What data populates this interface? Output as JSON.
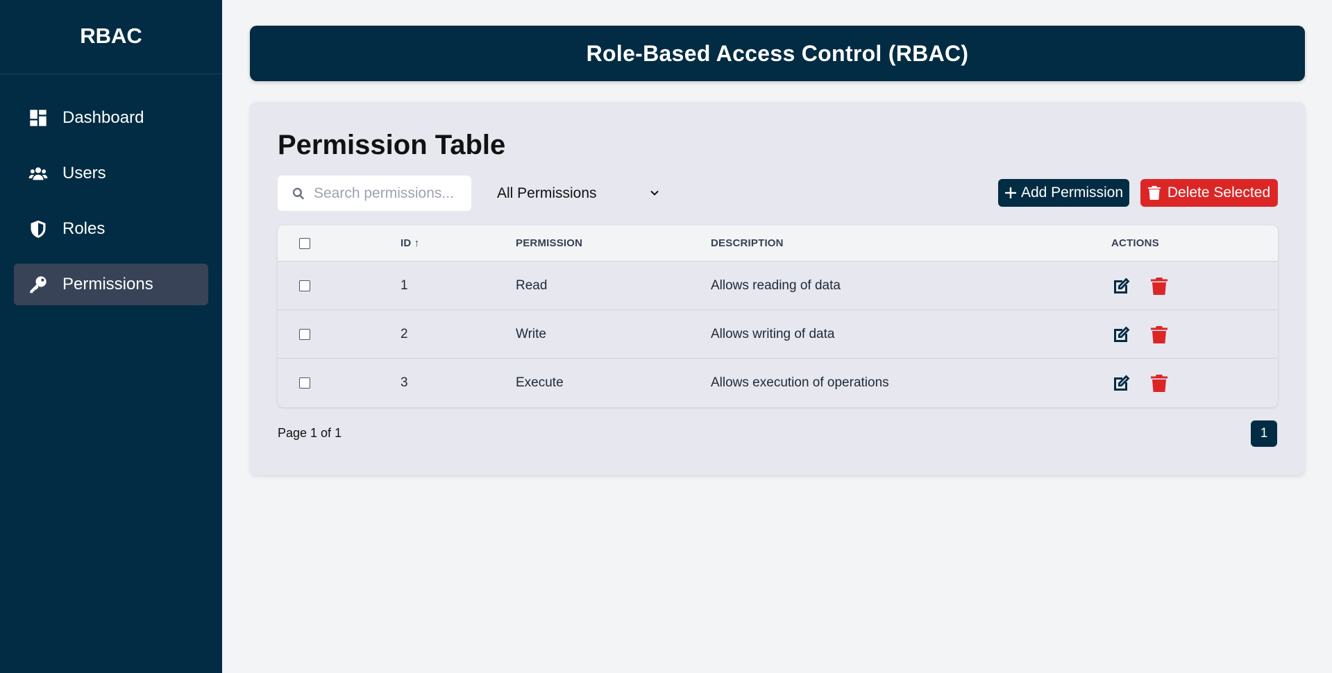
{
  "sidebar": {
    "brand": "RBAC",
    "items": [
      {
        "label": "Dashboard",
        "icon": "dashboard-icon"
      },
      {
        "label": "Users",
        "icon": "users-icon"
      },
      {
        "label": "Roles",
        "icon": "shield-icon"
      },
      {
        "label": "Permissions",
        "icon": "key-icon",
        "active": true
      }
    ]
  },
  "header": {
    "title": "Role-Based Access Control (RBAC)"
  },
  "main": {
    "title": "Permission Table",
    "search_placeholder": "Search permissions...",
    "filter_value": "All Permissions",
    "add_label": "Add Permission",
    "delete_label": "Delete Selected",
    "table": {
      "headers": [
        "ID ↑",
        "PERMISSION",
        "DESCRIPTION",
        "ACTIONS"
      ],
      "rows": [
        {
          "id": "1",
          "permission": "Read",
          "description": "Allows reading of data"
        },
        {
          "id": "2",
          "permission": "Write",
          "description": "Allows writing of data"
        },
        {
          "id": "3",
          "permission": "Execute",
          "description": "Allows execution of operations"
        }
      ]
    },
    "page_info": "Page 1 of 1",
    "current_page": "1"
  },
  "colors": {
    "sidebar_bg": "#022c43",
    "active_item": "#384357",
    "danger": "#dc2626",
    "card_bg": "#e6e7ef"
  }
}
